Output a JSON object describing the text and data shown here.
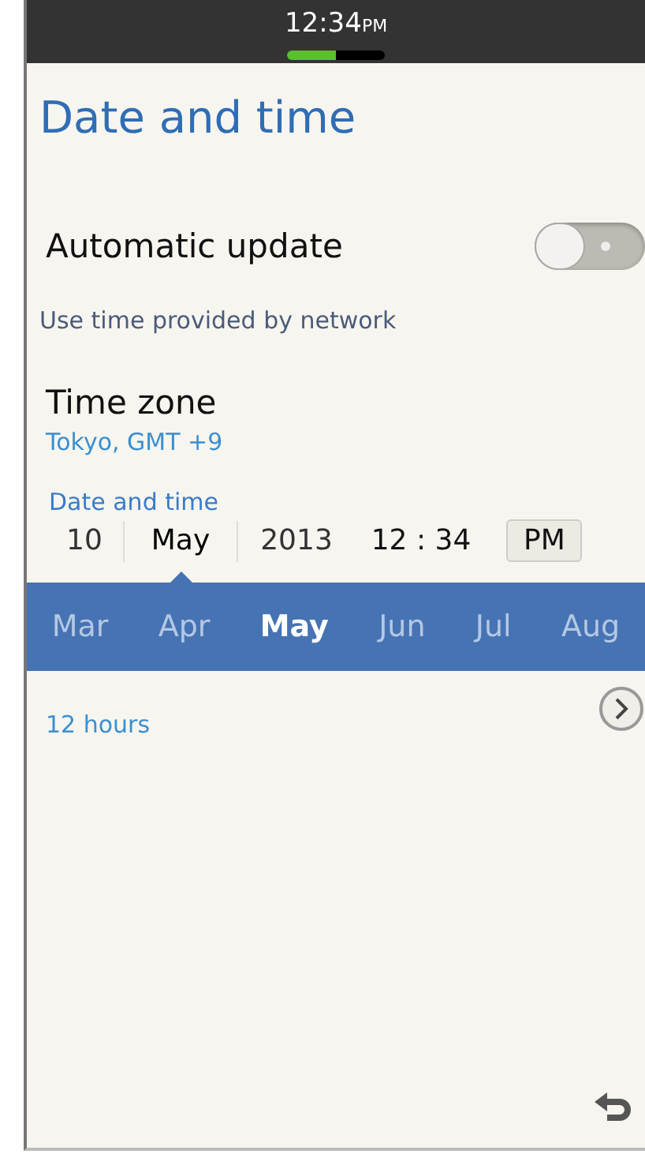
{
  "status_bar": {
    "time": "12:34",
    "ampm": "PM",
    "level": 0.5
  },
  "title": "Date and time",
  "automatic_update": {
    "label": "Automatic update",
    "on": false,
    "description": "Use time provided by network"
  },
  "time_zone": {
    "label": "Time zone",
    "value": "Tokyo, GMT +9"
  },
  "date_time": {
    "label": "Date and time",
    "fields": [
      {
        "kind": "spinner",
        "value": "10",
        "selected": false
      },
      {
        "kind": "spinner",
        "value": "May",
        "selected": true
      },
      {
        "kind": "spinner",
        "value": "2013",
        "selected": false
      },
      {
        "kind": "time",
        "value": "12 : 34"
      },
      {
        "kind": "toggle",
        "value": "PM"
      }
    ]
  },
  "month_picker": [
    {
      "label": "Mar",
      "selected": false
    },
    {
      "label": "Apr",
      "selected": false
    },
    {
      "label": "May",
      "selected": true
    },
    {
      "label": "Jun",
      "selected": false
    },
    {
      "label": "Jul",
      "selected": false
    },
    {
      "label": "Aug",
      "selected": false
    }
  ],
  "time_format": {
    "value": "12 hours"
  }
}
